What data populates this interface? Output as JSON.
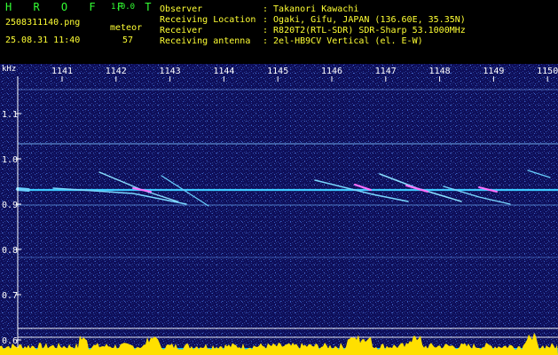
{
  "app": {
    "name": "H R O F F T",
    "version": "1.0.0"
  },
  "file": {
    "filename": "2508311140.png",
    "timestamp": "25.08.31 11:40"
  },
  "meteor": {
    "label": "meteor",
    "count": "57"
  },
  "info": {
    "labels": [
      "Observer",
      "Receiving Location",
      "Receiver",
      "Receiving antenna"
    ],
    "values": [
      ": Takanori Kawachi",
      ": Ogaki, Gifu, JAPAN (136.60E, 35.35N)",
      ": R820T2(RTL-SDR) SDR-Sharp 53.1000MHz",
      ": 2el-HB9CV Vertical (el. E-W)"
    ]
  },
  "spectrogram": {
    "unit": "kHz",
    "time_labels": [
      "1141",
      "1142",
      "1143",
      "1144",
      "1145",
      "1146",
      "1147",
      "1148",
      "1149",
      "1150"
    ],
    "freq_labels": [
      "1.1",
      "1.0",
      "0.9",
      "0.8",
      "0.7",
      "0.6"
    ],
    "colors": {
      "background": "#101060",
      "trace": "#40c0ff",
      "strong": "#ff60ff",
      "axis": "#ffffff",
      "level": "#ffe000"
    }
  }
}
